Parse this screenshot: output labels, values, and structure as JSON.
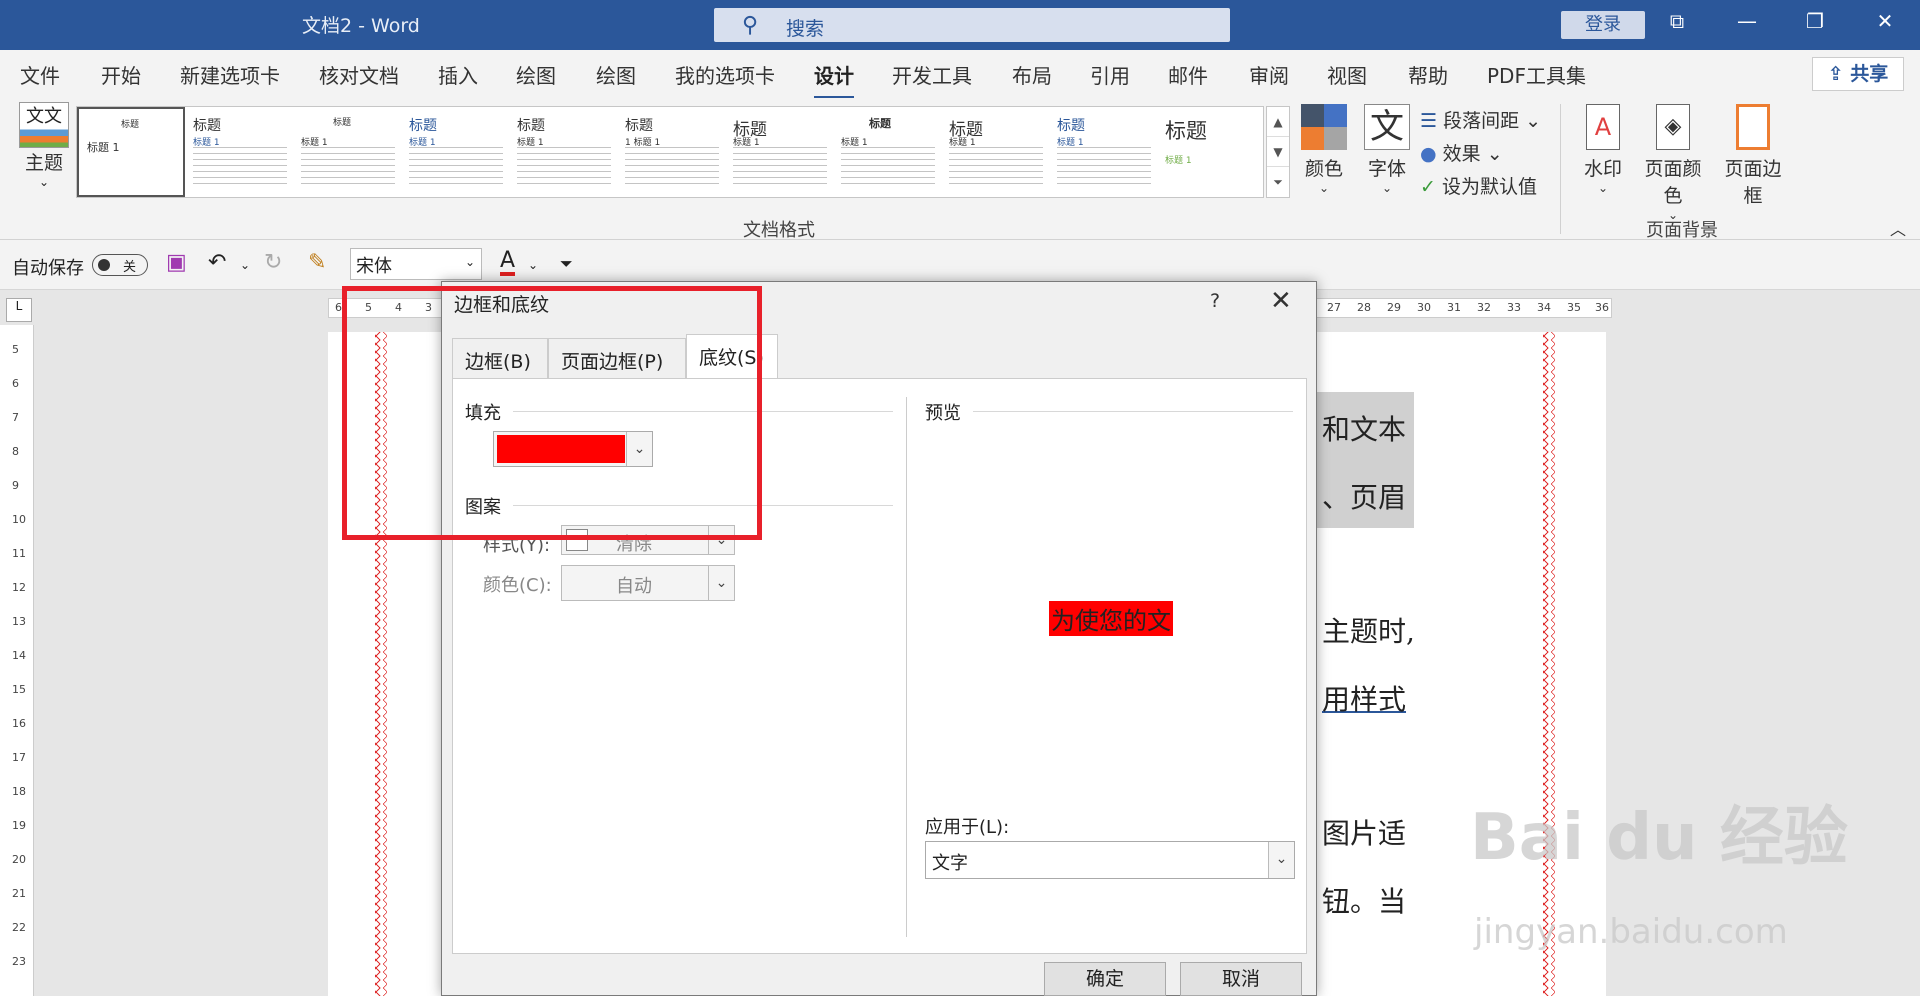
{
  "titlebar": {
    "doc_title": "文档2  -  Word",
    "search_placeholder": "搜索",
    "login": "登录",
    "ctrl_ribbon": "⧉",
    "ctrl_min": "—",
    "ctrl_max": "❐",
    "ctrl_close": "✕"
  },
  "tabs": [
    "文件",
    "开始",
    "新建选项卡",
    "核对文档",
    "插入",
    "绘图",
    "绘图",
    "我的选项卡",
    "设计",
    "开发工具",
    "布局",
    "引用",
    "邮件",
    "审阅",
    "视图",
    "帮助",
    "PDF工具集"
  ],
  "active_tab": "设计",
  "share": "共享",
  "ribbon": {
    "theme_label": "主题",
    "theme_icon_text": "文文",
    "gallery_items": [
      {
        "title": "标题",
        "h1": "标题 1"
      },
      {
        "title": "标题",
        "h1": "标题 1"
      },
      {
        "title": "标题",
        "h1": "标题 1"
      },
      {
        "title": "标题",
        "h1": "标题 1"
      },
      {
        "title": "标题",
        "h1": "标题 1"
      },
      {
        "title": "标题",
        "h1": "1 标题 1"
      },
      {
        "title": "标题",
        "h1": "标题 1"
      },
      {
        "title": "标题",
        "h1": "标题 1"
      },
      {
        "title": "标题",
        "h1": "标题 1"
      },
      {
        "title": "标题",
        "h1": "标题 1"
      },
      {
        "title": "标题",
        "h1": "标题 1"
      }
    ],
    "doc_format_group": "文档格式",
    "colors_label": "颜色",
    "fonts_label": "字体",
    "fonts_icon_text": "文",
    "paragraph_spacing": "段落间距",
    "effects": "效果",
    "set_default": "设为默认值",
    "watermark": "水印",
    "page_color": "页面颜色",
    "page_border": "页面边框",
    "page_bg_group": "页面背景",
    "collapse_icon": "︿"
  },
  "qat": {
    "autosave": "自动保存",
    "toggle_state": "关",
    "font_name": "宋体",
    "font_color_letter": "A"
  },
  "ruler": {
    "h_left": [
      "6",
      "5",
      "4",
      "3"
    ],
    "h_right": [
      "27",
      "28",
      "29",
      "30",
      "31",
      "32",
      "33",
      "34",
      "35",
      "36"
    ],
    "v": [
      "5",
      "6",
      "7",
      "8",
      "9",
      "10",
      "11",
      "12",
      "13",
      "14",
      "15",
      "16",
      "17",
      "18",
      "19",
      "20",
      "21",
      "22",
      "23"
    ]
  },
  "document": {
    "lines": [
      "和文本",
      "、页眉",
      "主题时,",
      "用样式",
      "图片适",
      "钮。当"
    ]
  },
  "dialog": {
    "title": "边框和底纹",
    "help": "?",
    "close": "✕",
    "tabs": [
      "边框(B)",
      "页面边框(P)",
      "底纹(S)"
    ],
    "active_tab": "底纹(S)",
    "fill_label": "填充",
    "fill_color": "#ff0000",
    "pattern_label": "图案",
    "style_label": "样式(Y):",
    "style_value": "清除",
    "color_label": "颜色(C):",
    "color_value": "自动",
    "preview_label": "预览",
    "preview_text": "为使您的文",
    "apply_label": "应用于(L):",
    "apply_value": "文字",
    "ok": "确定",
    "cancel": "取消"
  },
  "watermark": {
    "main": "Bai du 经验",
    "sub": "jingyan.baidu.com"
  },
  "highlight_color": "#e8202a"
}
